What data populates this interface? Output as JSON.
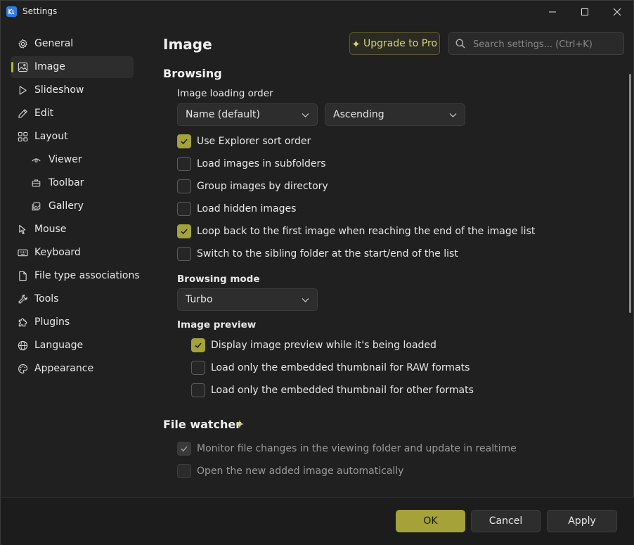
{
  "window": {
    "title": "Settings"
  },
  "sidebar": {
    "items": [
      {
        "label": "General",
        "icon": "gear-icon"
      },
      {
        "label": "Image",
        "icon": "image-icon",
        "active": true
      },
      {
        "label": "Slideshow",
        "icon": "play-icon"
      },
      {
        "label": "Edit",
        "icon": "pencil-icon"
      },
      {
        "label": "Layout",
        "icon": "grid-icon"
      },
      {
        "label": "Viewer",
        "icon": "eye-icon",
        "sub": true
      },
      {
        "label": "Toolbar",
        "icon": "toolbox-icon",
        "sub": true
      },
      {
        "label": "Gallery",
        "icon": "gallery-icon",
        "sub": true
      },
      {
        "label": "Mouse",
        "icon": "mouse-icon"
      },
      {
        "label": "Keyboard",
        "icon": "keyboard-icon"
      },
      {
        "label": "File type associations",
        "icon": "file-icon"
      },
      {
        "label": "Tools",
        "icon": "wrench-icon"
      },
      {
        "label": "Plugins",
        "icon": "puzzle-icon"
      },
      {
        "label": "Language",
        "icon": "globe-icon"
      },
      {
        "label": "Appearance",
        "icon": "palette-icon"
      }
    ]
  },
  "header": {
    "title": "Image",
    "upgrade_label": "Upgrade to Pro",
    "search_placeholder": "Search settings... (Ctrl+K)"
  },
  "browsing": {
    "title": "Browsing",
    "loading_order_label": "Image loading order",
    "order_by": "Name (default)",
    "order_direction": "Ascending",
    "options": [
      {
        "label": "Use Explorer sort order",
        "checked": true
      },
      {
        "label": "Load images in subfolders",
        "checked": false
      },
      {
        "label": "Group images by directory",
        "checked": false
      },
      {
        "label": "Load hidden images",
        "checked": false
      },
      {
        "label": "Loop back to the first image when reaching the end of the image list",
        "checked": true
      },
      {
        "label": "Switch to the sibling folder at the start/end of the list",
        "checked": false
      }
    ],
    "mode_label": "Browsing mode",
    "mode_value": "Turbo",
    "preview_label": "Image preview",
    "preview_options": [
      {
        "label": "Display image preview while it's being loaded",
        "checked": true
      },
      {
        "label": "Load only the embedded thumbnail for RAW formats",
        "checked": false
      },
      {
        "label": "Load only the embedded thumbnail for other formats",
        "checked": false
      }
    ]
  },
  "file_watcher": {
    "title": "File watcher",
    "options": [
      {
        "label": "Monitor file changes in the viewing folder and update in realtime",
        "checked": true,
        "disabled": true
      },
      {
        "label": "Open the new added image automatically",
        "checked": false,
        "disabled": true
      }
    ]
  },
  "footer": {
    "ok_label": "OK",
    "cancel_label": "Cancel",
    "apply_label": "Apply"
  },
  "colors": {
    "accent": "#a4a238",
    "background": "#202020"
  }
}
